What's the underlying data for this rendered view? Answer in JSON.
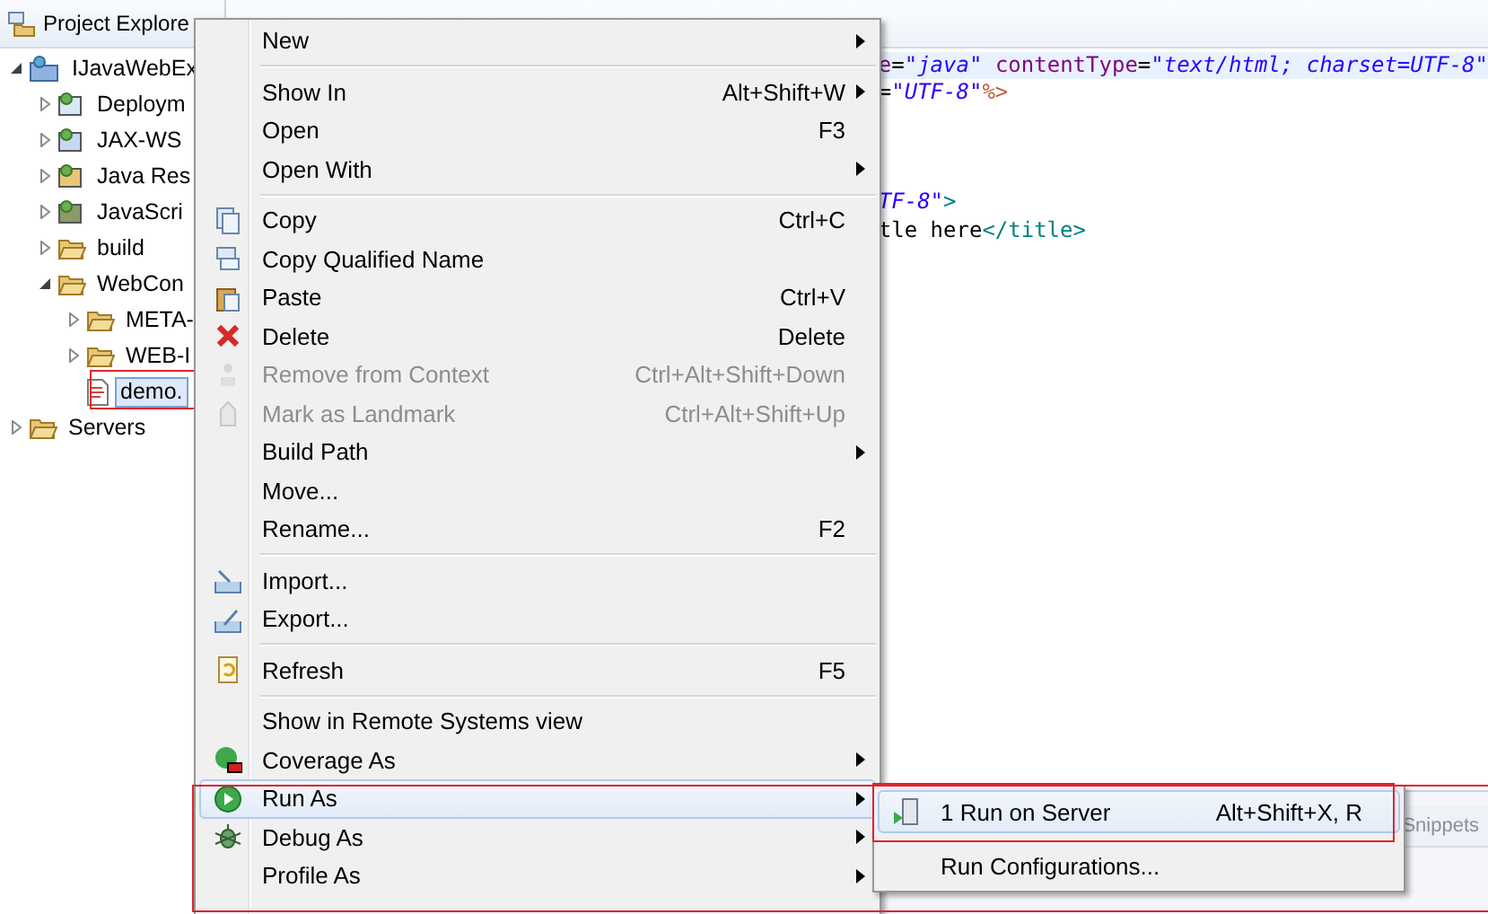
{
  "explorer": {
    "title": "Project Explore",
    "tree": [
      {
        "label": "IJavaWebEx",
        "expanded": true,
        "selected": false,
        "children": [
          {
            "label": "Deploym",
            "expanded": false,
            "selected": false
          },
          {
            "label": "JAX-WS",
            "expanded": false,
            "selected": false
          },
          {
            "label": "Java Res",
            "expanded": false,
            "selected": false
          },
          {
            "label": "JavaScri",
            "expanded": false,
            "selected": false
          },
          {
            "label": "build",
            "expanded": false,
            "selected": false
          },
          {
            "label": "WebCon",
            "expanded": true,
            "selected": false,
            "children": [
              {
                "label": "META-",
                "expanded": false,
                "selected": false
              },
              {
                "label": "WEB-I",
                "expanded": false,
                "selected": false
              },
              {
                "label": "demo.",
                "selected": true
              }
            ]
          }
        ]
      },
      {
        "label": "Servers",
        "expanded": false,
        "selected": false
      }
    ]
  },
  "editor": {
    "lines": [
      {
        "highlighted": true,
        "tokens": [
          {
            "kind": "attr",
            "text": "e"
          },
          {
            "kind": "plain",
            "text": "="
          },
          {
            "kind": "value",
            "text": "\"java\""
          },
          {
            "kind": "attr",
            "text": " contentType"
          },
          {
            "kind": "plain",
            "text": "="
          },
          {
            "kind": "value",
            "text": "\"text/html; charset=UTF-8\""
          }
        ]
      },
      {
        "highlighted": false,
        "tokens": [
          {
            "kind": "plain",
            "text": "="
          },
          {
            "kind": "value",
            "text": "\"UTF-8\""
          },
          {
            "kind": "directive",
            "text": "%>"
          }
        ]
      },
      {
        "highlighted": false
      },
      {
        "highlighted": false
      },
      {
        "highlighted": false
      },
      {
        "highlighted": false,
        "tokens": [
          {
            "kind": "value",
            "text": "TF-8\""
          },
          {
            "kind": "tag",
            "text": ">"
          }
        ]
      },
      {
        "highlighted": false,
        "tokens": [
          {
            "kind": "plain",
            "text": "tle here"
          },
          {
            "kind": "tag",
            "text": "</title>"
          }
        ]
      }
    ]
  },
  "bottom_panel": {
    "tabs": [
      {
        "label": "Snippets",
        "selected": false
      }
    ]
  },
  "context_menu": {
    "items": [
      {
        "kind": "item",
        "label": "New",
        "submenu": true,
        "disabled": false,
        "selected": false
      },
      {
        "kind": "separator"
      },
      {
        "kind": "item",
        "label": "Show In",
        "shortcut": "Alt+Shift+W",
        "submenu": true,
        "disabled": false,
        "selected": false
      },
      {
        "kind": "item",
        "label": "Open",
        "shortcut": "F3",
        "submenu": false,
        "disabled": false,
        "selected": false
      },
      {
        "kind": "item",
        "label": "Open With",
        "submenu": true,
        "disabled": false,
        "selected": false
      },
      {
        "kind": "separator"
      },
      {
        "kind": "item",
        "label": "Copy",
        "shortcut": "Ctrl+C",
        "submenu": false,
        "disabled": false,
        "selected": false
      },
      {
        "kind": "item",
        "label": "Copy Qualified Name",
        "submenu": false,
        "disabled": false,
        "selected": false
      },
      {
        "kind": "item",
        "label": "Paste",
        "shortcut": "Ctrl+V",
        "submenu": false,
        "disabled": false,
        "selected": false
      },
      {
        "kind": "item",
        "label": "Delete",
        "shortcut": "Delete",
        "submenu": false,
        "disabled": false,
        "selected": false
      },
      {
        "kind": "item",
        "label": "Remove from Context",
        "shortcut": "Ctrl+Alt+Shift+Down",
        "submenu": false,
        "disabled": true,
        "selected": false
      },
      {
        "kind": "item",
        "label": "Mark as Landmark",
        "shortcut": "Ctrl+Alt+Shift+Up",
        "submenu": false,
        "disabled": true,
        "selected": false
      },
      {
        "kind": "item",
        "label": "Build Path",
        "submenu": true,
        "disabled": false,
        "selected": false
      },
      {
        "kind": "item",
        "label": "Move...",
        "submenu": false,
        "disabled": false,
        "selected": false
      },
      {
        "kind": "item",
        "label": "Rename...",
        "shortcut": "F2",
        "submenu": false,
        "disabled": false,
        "selected": false
      },
      {
        "kind": "separator"
      },
      {
        "kind": "item",
        "label": "Import...",
        "submenu": false,
        "disabled": false,
        "selected": false
      },
      {
        "kind": "item",
        "label": "Export...",
        "submenu": false,
        "disabled": false,
        "selected": false
      },
      {
        "kind": "separator"
      },
      {
        "kind": "item",
        "label": "Refresh",
        "shortcut": "F5",
        "submenu": false,
        "disabled": false,
        "selected": false
      },
      {
        "kind": "separator"
      },
      {
        "kind": "item",
        "label": "Show in Remote Systems view",
        "submenu": false,
        "disabled": false,
        "selected": false
      },
      {
        "kind": "item",
        "label": "Coverage As",
        "submenu": true,
        "disabled": false,
        "selected": false
      },
      {
        "kind": "item",
        "label": "Run As",
        "submenu": true,
        "disabled": false,
        "selected": true
      },
      {
        "kind": "item",
        "label": "Debug As",
        "submenu": true,
        "disabled": false,
        "selected": false
      },
      {
        "kind": "item",
        "label": "Profile As",
        "submenu": true,
        "disabled": false,
        "selected": false
      }
    ]
  },
  "submenu": {
    "items": [
      {
        "label": "1 Run on Server",
        "shortcut": "Alt+Shift+X, R",
        "selected": true
      },
      {
        "label": "Run Configurations...",
        "selected": false
      }
    ]
  }
}
